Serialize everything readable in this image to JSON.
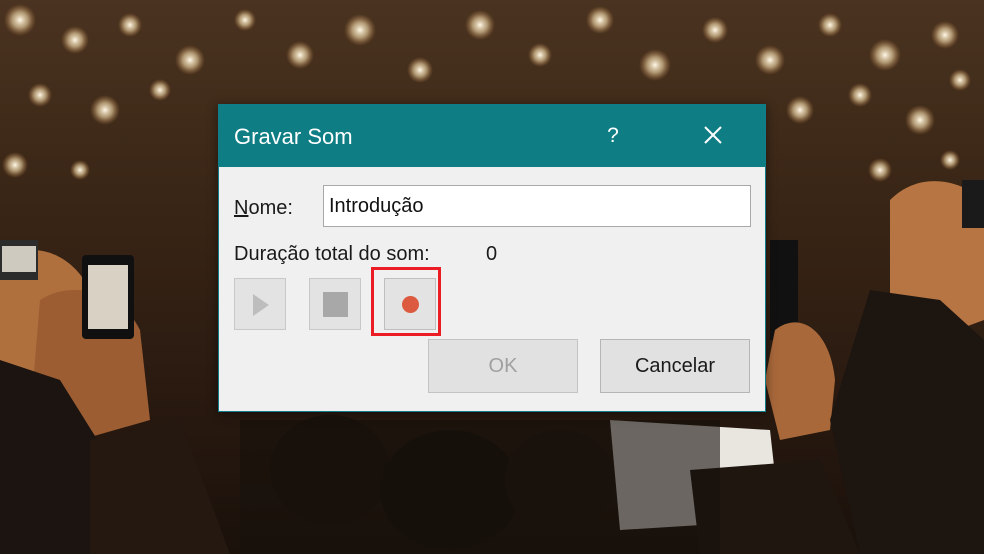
{
  "dialog": {
    "title": "Gravar Som",
    "help_label": "?",
    "close_icon": "close-icon",
    "accent_color": "#0f7e84"
  },
  "name_field": {
    "label_accel": "N",
    "label_rest": "ome:",
    "value": "Introdução"
  },
  "duration": {
    "label": "Duração total do som:",
    "value": "0"
  },
  "controls": {
    "play_icon": "play-icon",
    "stop_icon": "stop-icon",
    "record_icon": "record-icon",
    "record_color": "#dc5a3f",
    "highlight_color": "#ec1c24"
  },
  "buttons": {
    "ok_label": "OK",
    "ok_enabled": false,
    "cancel_label": "Cancelar"
  }
}
